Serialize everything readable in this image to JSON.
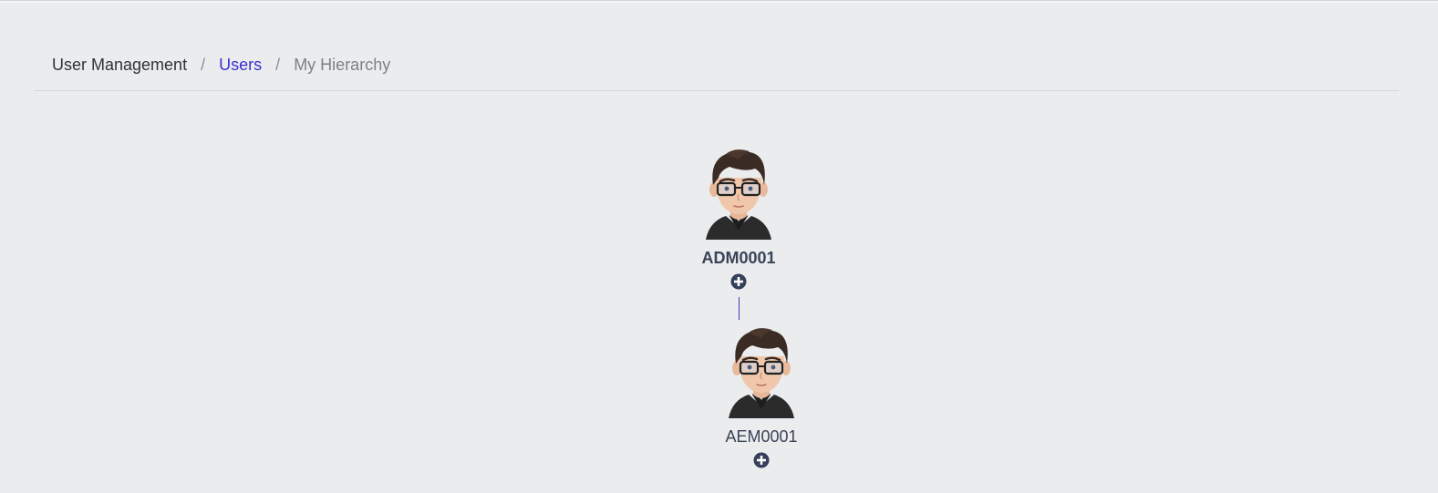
{
  "breadcrumb": {
    "items": [
      {
        "label": "User Management"
      },
      {
        "label": "Users"
      },
      {
        "label": "My Hierarchy"
      }
    ],
    "separator": "/"
  },
  "hierarchy": {
    "root": {
      "id": "ADM0001",
      "avatar": "user-avatar-icon",
      "expand_icon": "plus-circle-icon"
    },
    "child": {
      "id": "AEM0001",
      "avatar": "user-avatar-icon",
      "expand_icon": "plus-circle-icon"
    }
  },
  "colors": {
    "background": "#ebecee",
    "link": "#3a2fd1",
    "node_text": "#3b4457",
    "icon": "#343f5a",
    "connector": "#3b3fb0"
  }
}
